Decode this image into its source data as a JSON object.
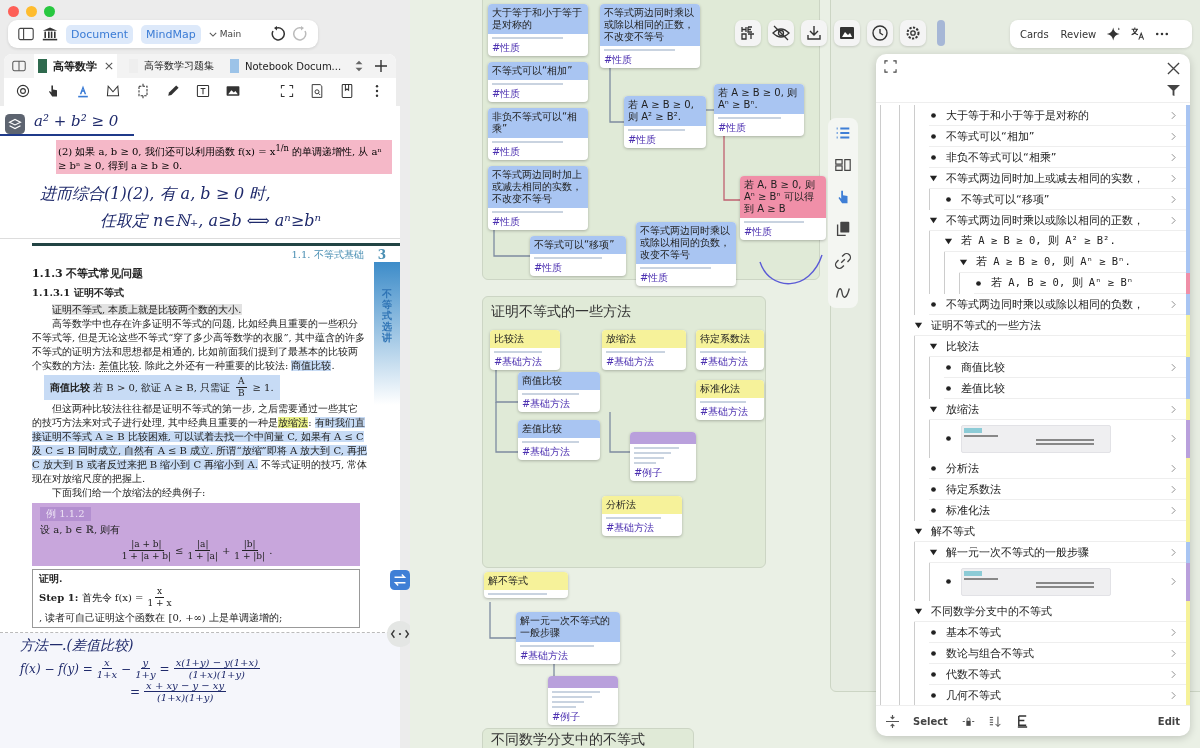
{
  "toolbar": {
    "modes": [
      {
        "label": "Document",
        "selected": true
      },
      {
        "label": "MindMap",
        "selected": true
      }
    ],
    "branch": "Main"
  },
  "doc_tabs": [
    {
      "title": "高等数学",
      "selected": true
    },
    {
      "title": "高等数学习题集",
      "selected": false
    },
    {
      "title": "Notebook Docum...",
      "selected": false
    }
  ],
  "tools": [
    {
      "kind": "rotate",
      "selected": false
    },
    {
      "kind": "hand",
      "selected": false
    },
    {
      "kind": "highlight",
      "selected": true
    },
    {
      "kind": "shape",
      "selected": false
    },
    {
      "kind": "crop",
      "selected": false
    },
    {
      "kind": "pencil",
      "selected": false
    },
    {
      "kind": "textbox",
      "selected": false
    },
    {
      "kind": "image",
      "selected": false
    },
    {
      "kind": "fullscreen",
      "selected": false
    },
    {
      "kind": "find",
      "selected": false
    },
    {
      "kind": "bookmark",
      "selected": false
    },
    {
      "kind": "more",
      "selected": false
    }
  ],
  "document": {
    "note_top": "a² + b² ≥ 0",
    "highlight_line": "(2) 如果 a, b ≥ 0, 我们还可以利用函数 f(x) = x$^{1/n}$ 的单调递增性, 从 aⁿ ≥ bⁿ ≥ 0, 得到 a ≥ b ≥ 0.",
    "handwriting": [
      "进而综合(1)(2), 有 a, b ≥ 0 时,",
      "任取定 n∈ℕ₊, a≥b ⟺ aⁿ≥bⁿ"
    ],
    "page": {
      "running_head": "1.1.  不等式基础",
      "page_number": "3",
      "side_tab": "不等式选讲",
      "section": "1.1.3   不等式常见问题",
      "subsection": "1.1.3.1   证明不等式",
      "paragraphs": [
        [
          {
            "text": "证明不等式, 本质上就是比较两个数的大小.",
            "kind": "grey"
          }
        ],
        [
          {
            "text": "高等数学中也存在许多证明不等式的问题, 比如经典且重要的一些积分不等式等, 但是无论这些不等式“穿了多少高等数学的衣服”, 其中蕴含的许多不等式的证明方法和思想都是相通的, 比如前面我们提到了最基本的比较两个实数的方法: ",
            "kind": "plain"
          },
          {
            "text": "差值比较",
            "kind": "underline"
          },
          {
            "text": ". 除此之外还有一种重要的比较法: ",
            "kind": "plain"
          },
          {
            "text": "商值比较",
            "kind": "blue"
          },
          {
            "text": ".",
            "kind": "plain"
          }
        ]
      ],
      "definition": [
        {
          "kind": "text",
          "text": "**商值比较**  若 B > 0, 欲证 A ≥ B, 只需证"
        },
        {
          "kind": "frac",
          "num": "A",
          "den": "B"
        },
        {
          "kind": "text",
          "text": "≥ 1."
        }
      ],
      "paragraphs_after": [
        [
          {
            "text": "但这两种比较法往往都是证明不等式的第一步, 之后需要通过一些其它的技巧方法来对式子进行处理, 其中经典且重要的一种是",
            "kind": "plain"
          },
          {
            "text": "放缩法",
            "kind": "yellow"
          },
          {
            "text": ": ",
            "kind": "plain"
          },
          {
            "text": "有时我们直接证明不等式 A ≥ B 比较困难, 可以试着去找一个中间量 C, 如果有 A ≤ C 及 C ≤ B 同时成立, 自然有 A ≤ B 成立. 所谓“放缩”即将 A 放大到 C, 再把 C 放大到 B 或者反过来把 B 缩小到 C 再缩小到 A.",
            "kind": "blue"
          },
          {
            "text": " 不等式证明的技巧, 常体现在对放缩尺度的把握上.",
            "kind": "plain"
          }
        ],
        [
          {
            "text": "下面我们给一个放缩法的经典例子:",
            "kind": "plain"
          }
        ]
      ],
      "example": {
        "label": "例 1.1.2",
        "statement": "设 a, b ∈ ℝ, 则有",
        "formula": [
          {
            "kind": "frac",
            "num": "|a + b|",
            "den": "1 + |a + b|"
          },
          {
            "kind": "text",
            "text": "≤"
          },
          {
            "kind": "frac",
            "num": "|a|",
            "den": "1 + |a|"
          },
          {
            "kind": "text",
            "text": "+"
          },
          {
            "kind": "frac",
            "num": "|b|",
            "den": "1 + |b|"
          },
          {
            "kind": "text",
            "text": "."
          }
        ]
      },
      "proof": {
        "title": "证明.",
        "step": [
          {
            "kind": "text",
            "text": "**Step 1:** 首先令 f(x) ="
          },
          {
            "kind": "frac",
            "num": "x",
            "den": "1 + x"
          },
          {
            "kind": "text",
            "text": ", 读者可自己证明这个函数在 [0, +∞) 上是单调递增的;"
          }
        ]
      }
    },
    "note_bottom": {
      "title": "方法一.(差值比较)",
      "lines": [
        [
          {
            "kind": "text",
            "text": "f(x) − f(y) ="
          },
          {
            "kind": "frac",
            "num": "x",
            "den": "1+x"
          },
          {
            "kind": "text",
            "text": "−"
          },
          {
            "kind": "frac",
            "num": "y",
            "den": "1+y"
          },
          {
            "kind": "text",
            "text": "="
          },
          {
            "kind": "frac",
            "num": "x(1+y) − y(1+x)",
            "den": "(1+x)(1+y)"
          }
        ],
        [
          {
            "kind": "text",
            "text": "="
          },
          {
            "kind": "frac",
            "num": "x + xy − y − xy",
            "den": "(1+x)(1+y)"
          }
        ]
      ]
    }
  },
  "mindmap": {
    "groups": [
      {
        "title": "证明不等式的一些方法"
      },
      {
        "title": "不同数学分支中的不等式"
      }
    ],
    "cards": [
      {
        "title": "大于等于和小于等于是对称的",
        "tag": "#性质",
        "color": "#a9c5f2"
      },
      {
        "title": "不等式可以“相加”",
        "tag": "#性质",
        "color": "#a9c5f2"
      },
      {
        "title": "非负不等式可以“相乘”",
        "tag": "#性质",
        "color": "#a9c5f2"
      },
      {
        "title": "不等式两边同时加上或减去相同的实数，不改变不等号",
        "tag": "#性质",
        "color": "#a9c5f2"
      },
      {
        "title": "不等式可以“移项”",
        "tag": "#性质",
        "color": "#a9c5f2"
      },
      {
        "title": "不等式两边同时乘以或除以相同的正数，不改变不等号",
        "tag": "#性质",
        "color": "#a9c5f2"
      },
      {
        "title": "若 A ≥ B ≥ 0, 则 A² ≥ B².",
        "tag": "#性质",
        "color": "#a9c5f2"
      },
      {
        "title": "若 A ≥ B ≥ 0, 则 Aⁿ ≥ Bⁿ.",
        "tag": "#性质",
        "color": "#a9c5f2"
      },
      {
        "title": "若 A, B ≥ 0, 则 Aⁿ ≥ Bⁿ 可以得到 A ≥ B",
        "tag": "#性质",
        "color": "#f08fa8"
      },
      {
        "title": "不等式两边同时乘以或除以相同的负数，改变不等号",
        "tag": "#性质",
        "color": "#a9c5f2"
      },
      {
        "title": "比较法",
        "tag": "#基础方法",
        "color": "#f6f29a"
      },
      {
        "title": "商值比较",
        "tag": "#基础方法",
        "color": "#a9c5f2"
      },
      {
        "title": "差值比较",
        "tag": "#基础方法",
        "color": "#a9c5f2"
      },
      {
        "title": "放缩法",
        "tag": "#基础方法",
        "color": "#f6f29a"
      },
      {
        "tag": "#例子",
        "color": "#b9a0dc"
      },
      {
        "title": "分析法",
        "tag": "#基础方法",
        "color": "#f6f29a"
      },
      {
        "title": "待定系数法",
        "tag": "#基础方法",
        "color": "#f6f29a"
      },
      {
        "title": "标准化法",
        "tag": "#基础方法",
        "color": "#f6f29a"
      },
      {
        "title": "解不等式",
        "color": "#f6f29a"
      },
      {
        "title": "解一元一次不等式的一般步骤",
        "tag": "#基础方法",
        "color": "#a9c5f2"
      },
      {
        "tag": "#例子",
        "color": "#b9a0dc"
      }
    ]
  },
  "view_tabs": [
    "Cards",
    "Review"
  ],
  "outline": {
    "continued_items": [
      {
        "label": "大于等于和小于等于是对称的",
        "kind": "text",
        "chevron": true,
        "color": "#a9c5f2"
      },
      {
        "label": "不等式可以“相加”",
        "kind": "text",
        "chevron": true,
        "color": "#a9c5f2"
      },
      {
        "label": "非负不等式可以“相乘”",
        "kind": "text",
        "chevron": true,
        "color": "#a9c5f2"
      },
      {
        "label": "不等式两边同时加上或减去相同的实数，",
        "kind": "text",
        "chevron": true,
        "color": "#a9c5f2",
        "expanded": true,
        "children": [
          {
            "label": "不等式可以“移项”",
            "kind": "text",
            "chevron": true,
            "color": "#a9c5f2"
          }
        ]
      },
      {
        "label": "不等式两边同时乘以或除以相同的正数，",
        "kind": "text",
        "chevron": true,
        "color": "#a9c5f2",
        "expanded": true,
        "children": [
          {
            "label": "若 A ≥ B ≥ 0, 则 A² ≥ B².",
            "kind": "formula",
            "chevron": false,
            "color": "#a9c5f2",
            "expanded": true,
            "children": [
              {
                "label": "若 A ≥ B ≥ 0, 则 Aⁿ ≥ Bⁿ.",
                "kind": "formula",
                "chevron": false,
                "color": "#a9c5f2",
                "expanded": true,
                "children": [
                  {
                    "label": "若 A, B ≥ 0, 则 Aⁿ ≥ Bⁿ",
                    "kind": "formula",
                    "chevron": false,
                    "color": "#f08fa8"
                  }
                ]
              }
            ]
          }
        ]
      },
      {
        "label": "不等式两边同时乘以或除以相同的负数，",
        "kind": "text",
        "chevron": true,
        "color": "#a9c5f2"
      }
    ],
    "items": [
      {
        "label": "证明不等式的一些方法",
        "kind": "text",
        "chevron": false,
        "color": "#f6f29a",
        "expanded": true,
        "children": [
          {
            "label": "比较法",
            "kind": "text",
            "chevron": false,
            "color": "#f6f29a",
            "expanded": true,
            "children": [
              {
                "label": "商值比较",
                "kind": "text",
                "chevron": true,
                "color": "#a9c5f2"
              },
              {
                "label": "差值比较",
                "kind": "text",
                "chevron": false,
                "color": "#a9c5f2"
              }
            ]
          },
          {
            "label": "放缩法",
            "kind": "text",
            "chevron": true,
            "color": "#f6f29a",
            "expanded": true,
            "children": [
              {
                "kind": "snippet",
                "chevron": true,
                "color": "#b9a0dc"
              }
            ]
          },
          {
            "label": "分析法",
            "kind": "text",
            "chevron": true,
            "color": "#f6f29a"
          },
          {
            "label": "待定系数法",
            "kind": "text",
            "chevron": true,
            "color": "#f6f29a"
          },
          {
            "label": "标准化法",
            "kind": "text",
            "chevron": true,
            "color": "#f6f29a"
          }
        ]
      },
      {
        "label": "解不等式",
        "kind": "text",
        "chevron": false,
        "color": "#f6f29a",
        "expanded": true,
        "children": [
          {
            "label": "解一元一次不等式的一般步骤",
            "kind": "text",
            "chevron": true,
            "color": "#a9c5f2",
            "expanded": true,
            "children": [
              {
                "kind": "snippet",
                "chevron": true,
                "color": "#b9a0dc"
              }
            ]
          }
        ]
      },
      {
        "label": "不同数学分支中的不等式",
        "kind": "text",
        "chevron": false,
        "color": "#f6f29a",
        "expanded": true,
        "children": [
          {
            "label": "基本不等式",
            "kind": "text",
            "chevron": true,
            "color": "#f6f29a"
          },
          {
            "label": "数论与组合不等式",
            "kind": "text",
            "chevron": true,
            "color": "#f6f29a"
          },
          {
            "label": "代数不等式",
            "kind": "text",
            "chevron": true,
            "color": "#f6f29a"
          },
          {
            "label": "几何不等式",
            "kind": "text",
            "chevron": true,
            "color": "#f6f29a"
          }
        ]
      }
    ]
  },
  "outline_footer": {
    "select": "Select",
    "edit": "Edit"
  }
}
